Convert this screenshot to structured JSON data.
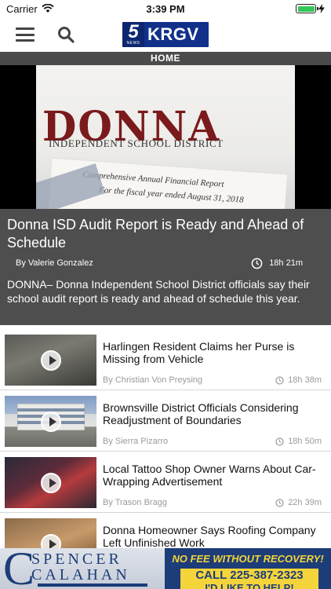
{
  "status_bar": {
    "carrier": "Carrier",
    "time": "3:39 PM"
  },
  "header": {
    "logo_number": "5",
    "logo_small": "NEWS",
    "logo_text": "KRGV"
  },
  "section": {
    "label": "HOME"
  },
  "hero": {
    "image_text_main": "DONNA",
    "image_text_sub": "INDEPENDENT SCHOOL DISTRICT",
    "image_doc_line1": "Comprehensive Annual Financial Report",
    "image_doc_line2": "For the fiscal year ended August 31, 2018",
    "title": "Donna ISD Audit Report is Ready and Ahead of Schedule",
    "author": "By Valerie Gonzalez",
    "time": "18h 21m",
    "summary": "DONNA– Donna Independent School District officials say their school audit report is ready and ahead of schedule this year."
  },
  "stories": [
    {
      "title": "Harlingen Resident Claims her Purse is Missing from Vehicle",
      "author": "By Christian Von Preysing",
      "time": "18h 38m"
    },
    {
      "title": "Brownsville District Officials Considering Readjustment of Boundaries",
      "author": "By Sierra Pizarro",
      "time": "18h 50m"
    },
    {
      "title": "Local Tattoo Shop Owner Warns About Car-Wrapping Advertisement",
      "author": "By Trason Bragg",
      "time": "22h 39m"
    },
    {
      "title": "Donna Homeowner Says Roofing Company Left Unfinished Work",
      "author": "",
      "time": ""
    }
  ],
  "ad": {
    "name_line1": "SPENCER",
    "name_line2": "CALAHAN",
    "headline": "NO FEE WITHOUT RECOVERY!",
    "phone": "CALL 225-387-2323",
    "tagline": "I'D LIKE TO HELP!"
  },
  "colors": {
    "brand_blue": "#11308a",
    "hero_bg": "#4e4e4e",
    "section_bar": "#4b4b4b",
    "ad_yellow": "#f4d43b"
  }
}
